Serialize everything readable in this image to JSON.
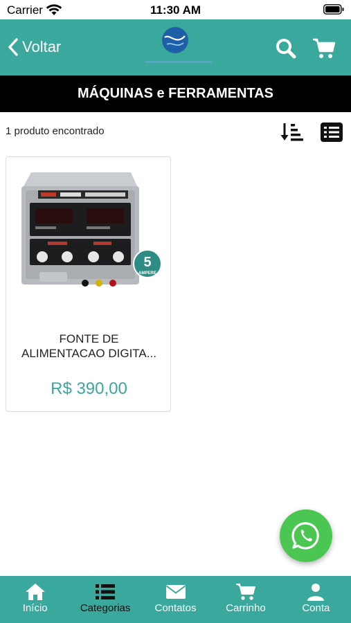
{
  "status_bar": {
    "carrier": "Carrier",
    "time": "11:30 AM"
  },
  "header": {
    "back_label": "Voltar",
    "accent_color": "#3aa89c"
  },
  "title_bar": {
    "title": "MÁQUINAS e FERRAMENTAS"
  },
  "results": {
    "count_text": "1 produto encontrado"
  },
  "product": {
    "name": "FONTE DE\nALIMENTACAO DIGITA...",
    "price": "R$ 390,00",
    "image_badge": "5",
    "image_badge_sub": "AMPERE"
  },
  "tabbar": {
    "items": [
      {
        "label": "Início",
        "icon": "home-icon"
      },
      {
        "label": "Categorias",
        "icon": "list-icon",
        "active": true
      },
      {
        "label": "Contatos",
        "icon": "envelope-icon"
      },
      {
        "label": "Carrinho",
        "icon": "cart-icon"
      },
      {
        "label": "Conta",
        "icon": "user-icon"
      }
    ]
  }
}
